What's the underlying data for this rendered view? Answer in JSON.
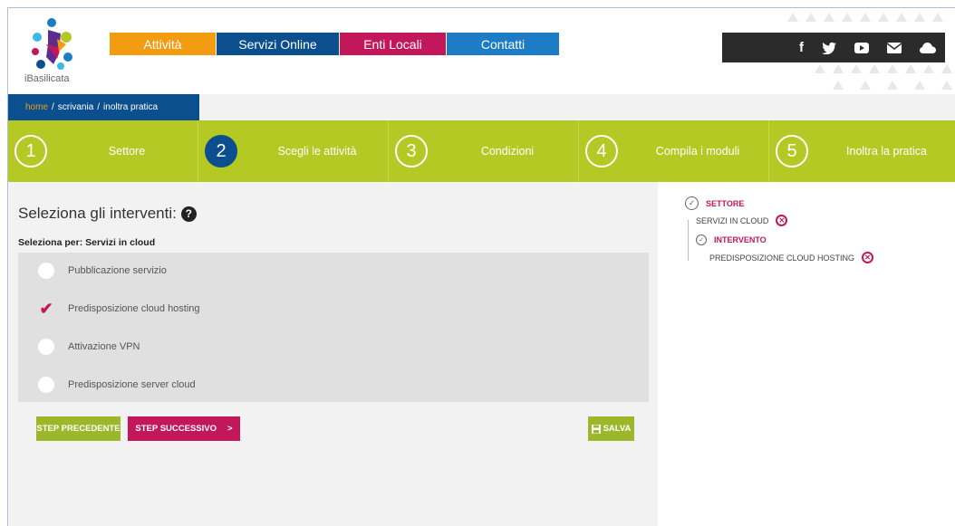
{
  "brand": {
    "name": "iBasilicata"
  },
  "nav": [
    {
      "label": "Attività",
      "color": "#f39c12"
    },
    {
      "label": "Servizi Online",
      "color": "#0b4f8e"
    },
    {
      "label": "Enti Locali",
      "color": "#c2185b"
    },
    {
      "label": "Contatti",
      "color": "#1e7cc7"
    }
  ],
  "social": [
    "facebook-icon",
    "twitter-icon",
    "youtube-icon",
    "mail-icon",
    "cloud-icon"
  ],
  "social_glyphs": {
    "facebook": "f"
  },
  "breadcrumb": {
    "home": "home",
    "sep1": "/",
    "item1": "scrivania",
    "sep2": "/",
    "item2": "inoltra pratica"
  },
  "steps": [
    {
      "num": "1",
      "label": "Settore",
      "active": false
    },
    {
      "num": "2",
      "label": "Scegli le attività",
      "active": true
    },
    {
      "num": "3",
      "label": "Condizioni",
      "active": false
    },
    {
      "num": "4",
      "label": "Compila i moduli",
      "active": false
    },
    {
      "num": "5",
      "label": "Inoltra la pratica",
      "active": false
    }
  ],
  "main": {
    "title": "Seleziona gli interventi:",
    "select_label": "Seleziona per: Servizi in cloud",
    "options": [
      {
        "label": "Pubblicazione servizio",
        "checked": false
      },
      {
        "label": "Predisposizione cloud hosting",
        "checked": true
      },
      {
        "label": "Attivazione VPN",
        "checked": false
      },
      {
        "label": "Predisposizione server cloud",
        "checked": false
      }
    ],
    "buttons": {
      "prev": "STEP PRECEDENTE",
      "next": "STEP SUCCESSIVO",
      "next_arrow": ">",
      "save": "SALVA"
    }
  },
  "sidebar": {
    "sector_head": "SETTORE",
    "sector_value": "SERVIZI IN CLOUD",
    "intervention_head": "INTERVENTO",
    "intervention_value": "PREDISPOSIZIONE CLOUD HOSTING"
  },
  "colors": {
    "green": "#b4c924",
    "blue": "#0b4f8e",
    "magenta": "#c2185b",
    "orange": "#f39c12"
  }
}
